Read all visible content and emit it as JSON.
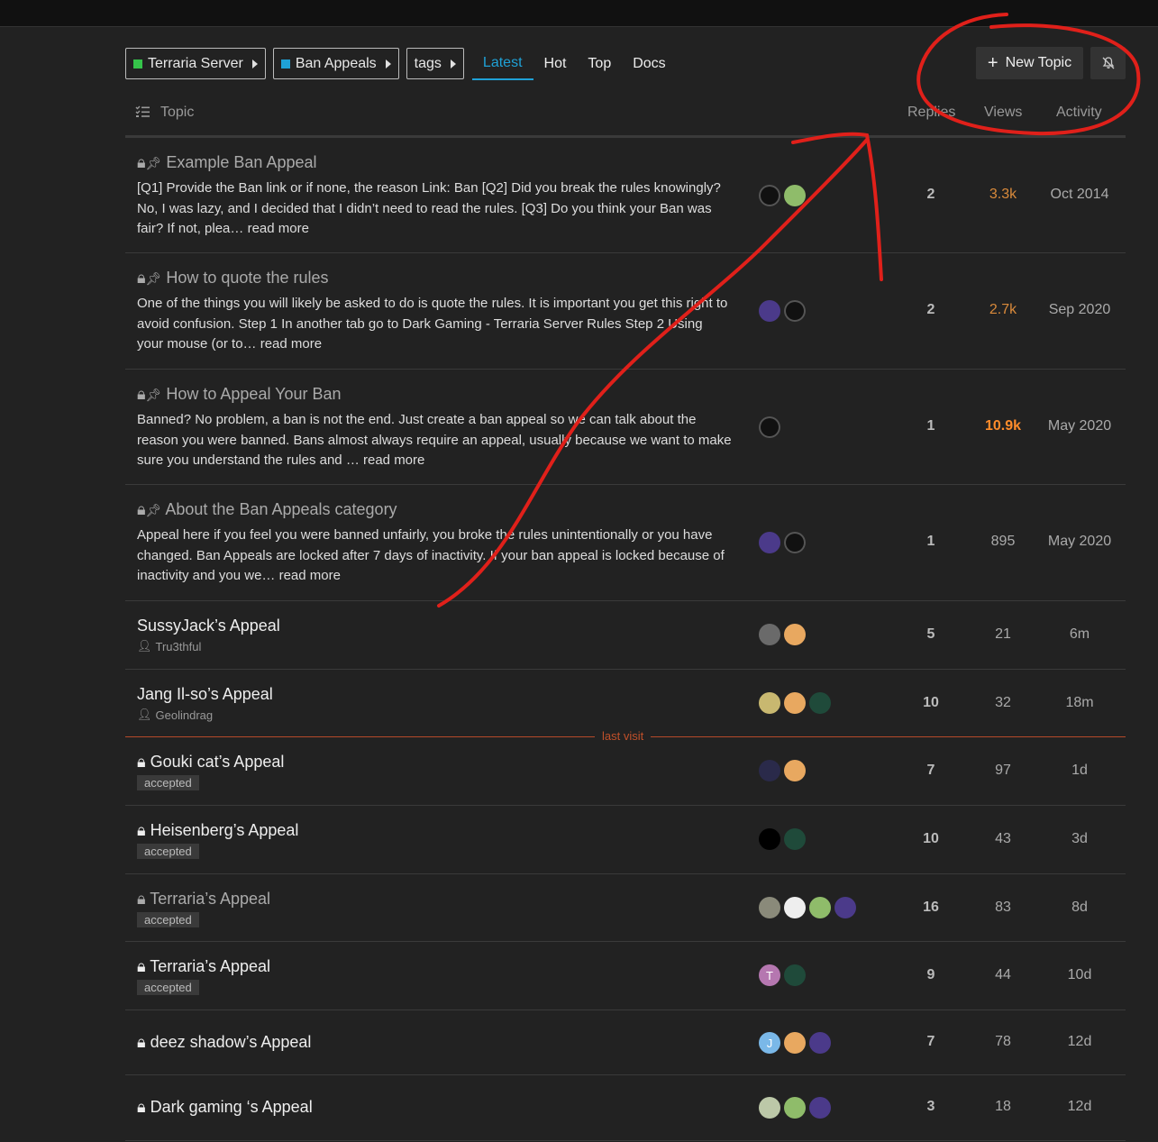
{
  "breadcrumbs": [
    {
      "label": "Terraria Server",
      "color": "#35c44a"
    },
    {
      "label": "Ban Appeals",
      "color": "#1fa1d6"
    },
    {
      "label": "tags",
      "color": ""
    }
  ],
  "nav_tabs": [
    "Latest",
    "Hot",
    "Top",
    "Docs"
  ],
  "new_topic_label": "New Topic",
  "headers": {
    "topic": "Topic",
    "replies": "Replies",
    "views": "Views",
    "activity": "Activity"
  },
  "last_visit_label": "last visit",
  "pinned_topics": [
    {
      "title": "Example Ban Appeal",
      "excerpt": "[Q1] Provide the Ban link or if none, the reason Link: Ban [Q2] Did you break the rules knowingly? No, I was lazy, and I decided that I didn’t need to read the rules. [Q3] Do you think your Ban was fair? If not, plea…",
      "read_more": "read more",
      "replies": "2",
      "views": "3.3k",
      "activity": "Oct 2014"
    },
    {
      "title": "How to quote the rules",
      "excerpt": "One of the things you will likely be asked to do is quote the rules. It is important you get this right to avoid confusion. Step 1 In another tab go to Dark Gaming - Terraria Server Rules Step 2 Using your mouse (or to…",
      "read_more": "read more",
      "replies": "2",
      "views": "2.7k",
      "activity": "Sep 2020"
    },
    {
      "title": "How to Appeal Your Ban",
      "excerpt": "Banned? No problem, a ban is not the end. Just create a ban appeal so we can talk about the reason you were banned. Bans almost always require an appeal, usually because we want to make sure you understand the rules and …",
      "read_more": "read more",
      "replies": "1",
      "views": "10.9k",
      "activity": "May 2020"
    },
    {
      "title": "About the Ban Appeals category",
      "excerpt": "Appeal here if you feel you were banned unfairly, you broke the rules unintentionally or you have changed. Ban Appeals are locked after 7 days of inactivity. If your ban appeal is locked because of inactivity and you we…",
      "read_more": "read more",
      "replies": "1",
      "views": "895",
      "activity": "May 2020"
    }
  ],
  "topics": [
    {
      "title": "SussyJack’s Appeal",
      "user": "Tru3thful",
      "replies": "5",
      "views": "21",
      "activity": "6m"
    },
    {
      "title": "Jang Il-so’s Appeal",
      "user": "Geolindrag",
      "replies": "10",
      "views": "32",
      "activity": "18m"
    },
    {
      "title": "Gouki cat’s Appeal",
      "tag": "accepted",
      "replies": "7",
      "views": "97",
      "activity": "1d"
    },
    {
      "title": "Heisenberg’s Appeal",
      "tag": "accepted",
      "replies": "10",
      "views": "43",
      "activity": "3d"
    },
    {
      "title": "Terraria’s Appeal",
      "tag": "accepted",
      "replies": "16",
      "views": "83",
      "activity": "8d"
    },
    {
      "title": "Terraria’s Appeal",
      "tag": "accepted",
      "replies": "9",
      "views": "44",
      "activity": "10d"
    },
    {
      "title": "deez shadow’s Appeal",
      "replies": "7",
      "views": "78",
      "activity": "12d"
    },
    {
      "title": "Dark gaming ‘s Appeal",
      "replies": "3",
      "views": "18",
      "activity": "12d"
    }
  ],
  "avatar_letters": {
    "t": "T",
    "j": "J"
  },
  "colors": {
    "accent": "#1fa1d6",
    "hot_views": "#ff8c2b",
    "annotation": "#e0201a",
    "last_visit": "#c0502a"
  }
}
